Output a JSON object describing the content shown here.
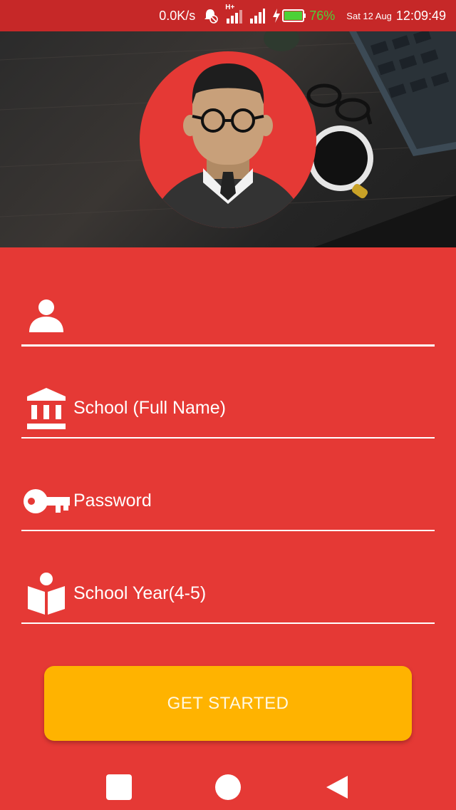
{
  "status_bar": {
    "net_speed": "0.0K/s",
    "network_type": "H+",
    "battery_percent": "76%",
    "date": "Sat 12 Aug",
    "time": "12:09:49",
    "icons": [
      "alarm-muted-icon",
      "signal-h-plus-icon",
      "signal-icon",
      "charging-icon",
      "battery-icon"
    ]
  },
  "hero": {
    "avatar": "student-avatar",
    "background": "desk-laptop-coffee-photo"
  },
  "form": {
    "name_field": {
      "value": "",
      "placeholder": "",
      "icon": "person-icon"
    },
    "school_field": {
      "placeholder": "School (Full Name)",
      "icon": "institution-icon"
    },
    "password_field": {
      "placeholder": "Password",
      "icon": "key-icon"
    },
    "school_year_field": {
      "placeholder": "School Year(4-5)",
      "icon": "reading-student-icon"
    },
    "submit_label": "GET STARTED"
  },
  "nav_bar": {
    "buttons": [
      "recent-apps-icon",
      "home-icon",
      "back-icon"
    ]
  },
  "colors": {
    "primary": "#e53935",
    "status_bar": "#c62828",
    "button": "#ffb300",
    "battery_text": "#4cd137"
  }
}
